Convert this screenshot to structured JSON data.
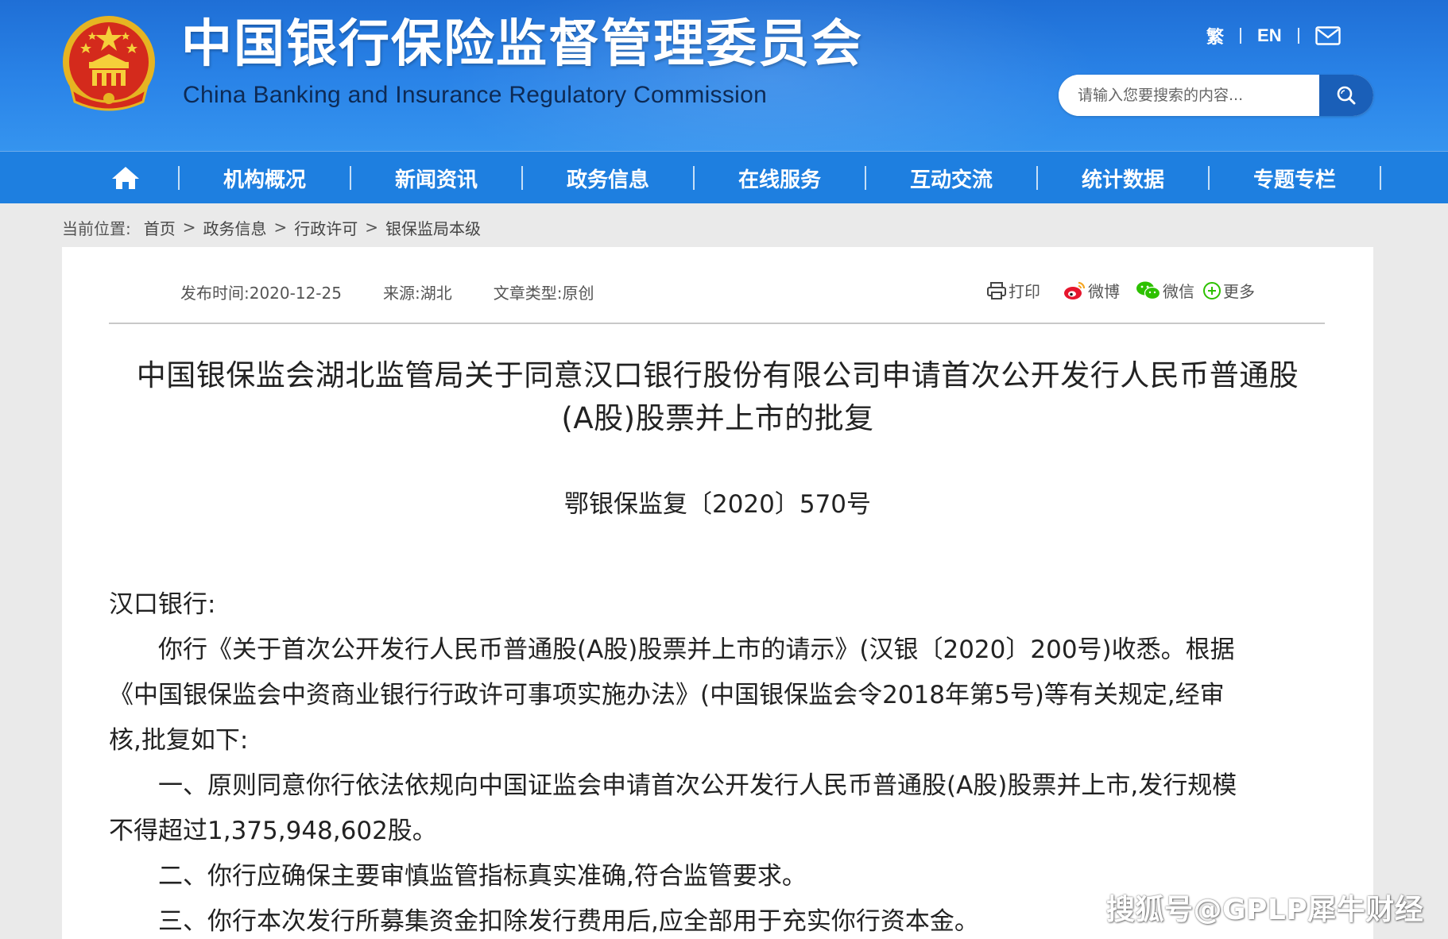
{
  "header": {
    "title_cn": "中国银行保险监督管理委员会",
    "title_en": "China Banking and Insurance Regulatory Commission",
    "lang_traditional": "繁",
    "lang_english": "EN",
    "mail_icon": "mail-icon"
  },
  "search": {
    "placeholder": "请输入您要搜索的内容...",
    "button_icon": "search-icon"
  },
  "nav": {
    "home_icon": "home-icon",
    "items": [
      "机构概况",
      "新闻资讯",
      "政务信息",
      "在线服务",
      "互动交流",
      "统计数据",
      "专题专栏"
    ]
  },
  "breadcrumb": {
    "label": "当前位置:",
    "items": [
      "首页",
      "政务信息",
      "行政许可",
      "银保监局本级"
    ],
    "separator": ">"
  },
  "article": {
    "meta": {
      "publish_time": "发布时间:2020-12-25",
      "source": "来源:湖北",
      "type": "文章类型:原创"
    },
    "share": {
      "print": "打印",
      "weibo": "微博",
      "wechat": "微信",
      "more": "更多"
    },
    "title_line1": "中国银保监会湖北监管局关于同意汉口银行股份有限公司申请首次公开发行人民币普通股",
    "title_line2": "(A股)股票并上市的批复",
    "doc_number": "鄂银保监复〔2020〕570号",
    "body": [
      "汉口银行:",
      "　　你行《关于首次公开发行人民币普通股(A股)股票并上市的请示》(汉银〔2020〕200号)收悉。根据",
      "《中国银保监会中资商业银行行政许可事项实施办法》(中国银保监会令2018年第5号)等有关规定,经审",
      "核,批复如下:",
      "　　一、原则同意你行依法依规向中国证监会申请首次公开发行人民币普通股(A股)股票并上市,发行规模",
      "不得超过1,375,948,602股。",
      "　　二、你行应确保主要审慎监管指标真实准确,符合监管要求。",
      "　　三、你行本次发行所募集资金扣除发行费用后,应全部用于充实你行资本金。"
    ]
  },
  "watermark": "搜狐号@GPLP犀牛财经"
}
